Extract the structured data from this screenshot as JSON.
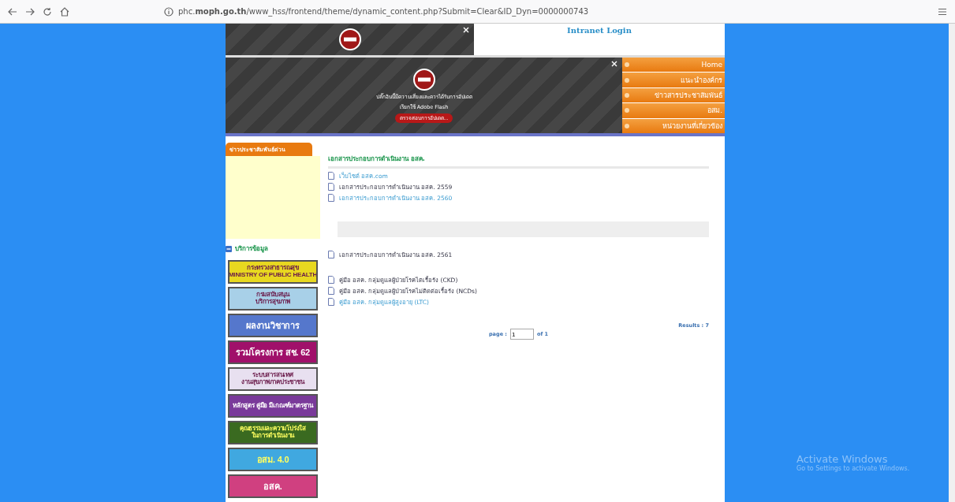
{
  "browser": {
    "url": "phc.**moph.go.th**/www_hss/frontend/theme/dynamic_content.php?Submit=Clear&ID_Dyn=0000000743"
  },
  "header": {
    "intranet_link": "Intranet Login",
    "flash_notice": {
      "message": "ปลั๊กอินนี้มีความเสี่ยงและควรได้รับการอัปเดต",
      "action_hint": "เรียกใช้ Adobe Flash",
      "button": "ตรวจสอบการอัปเดต..."
    },
    "nav": [
      "Home",
      "แนะนำองค์กร",
      "ข่าวสารประชาสัมพันธ์",
      "อสม.",
      "หน่วยงานที่เกี่ยวข้อง"
    ]
  },
  "sidebar": {
    "urgent_news": "ข่าวประชาสัมพันธ์ด่วน",
    "services": "บริการข้อมูล",
    "banners": [
      {
        "lines": [
          "กระทรวงสาธารณสุข",
          "MINISTRY OF PUBLIC HEALTH"
        ],
        "color": "#e8d820",
        "kind": "light"
      },
      {
        "lines": [
          "กรมสนับสนุน",
          "บริการสุขภาพ"
        ],
        "color": "#a8d0e8",
        "kind": "light"
      },
      {
        "lines": [
          "ผลงานวิชาการ"
        ],
        "color": "#5577cc",
        "kind": "dark"
      },
      {
        "lines": [
          "รวมโครงการ สช. 62"
        ],
        "color": "#a0106a",
        "kind": "dark"
      },
      {
        "lines": [
          "ระบบสารสนเทศ",
          "งานสุขภาพภาคประชาชน"
        ],
        "color": "#e8e0f0",
        "kind": "light"
      },
      {
        "lines": [
          "หลักสูตร คู่มือ มีเกณฑ์มาตรฐาน"
        ],
        "color": "#7a3a9a",
        "kind": "dark"
      },
      {
        "lines": [
          "คุณธรรมและความโปร่งใส",
          "ในการดำเนินงาน"
        ],
        "color": "#3a6a20",
        "kind": "green"
      },
      {
        "lines": [
          "อสม. 4.0"
        ],
        "color": "#40a8e0",
        "kind": "green"
      },
      {
        "lines": [
          "อสค."
        ],
        "color": "#d04080",
        "kind": "dark"
      }
    ]
  },
  "content": {
    "title": "เอกสารประกอบการดำเนินงาน อสค.",
    "blocks": [
      {
        "kind": "list",
        "items": [
          {
            "text": "เว็บไซต์ อสค.com",
            "kind": "link"
          },
          {
            "text": "เอกสารประกอบการดำเนินงาน อสค. 2559",
            "kind": "plain"
          },
          {
            "text": "เอกสารประกอบการดำเนินงาน อสค. 2560",
            "kind": "link"
          }
        ]
      },
      {
        "kind": "bar"
      },
      {
        "kind": "list",
        "items": [
          {
            "text": "เอกสารประกอบการดำเนินงาน อสค. 2561",
            "kind": "plain"
          }
        ]
      },
      {
        "kind": "list",
        "items": [
          {
            "text": "คู่มือ อสค. กลุ่มดูแลผู้ป่วยโรคไตเรื้อรัง (CKD)",
            "kind": "plain"
          },
          {
            "text": "คู่มือ อสค. กลุ่มดูแลผู้ป่วยโรคไม่ติดต่อเรื้อรัง (NCDs)",
            "kind": "plain"
          },
          {
            "text": "คู่มือ อสค. กลุ่มดูแลผู้สูงอายุ (LTC)",
            "kind": "link"
          }
        ]
      }
    ],
    "results": "Results : 7",
    "pager": {
      "label": "page :",
      "value": "1",
      "total": "of 1"
    }
  },
  "os_notice": {
    "title": "Activate Windows",
    "subtitle": "Go to Settings to activate Windows."
  }
}
